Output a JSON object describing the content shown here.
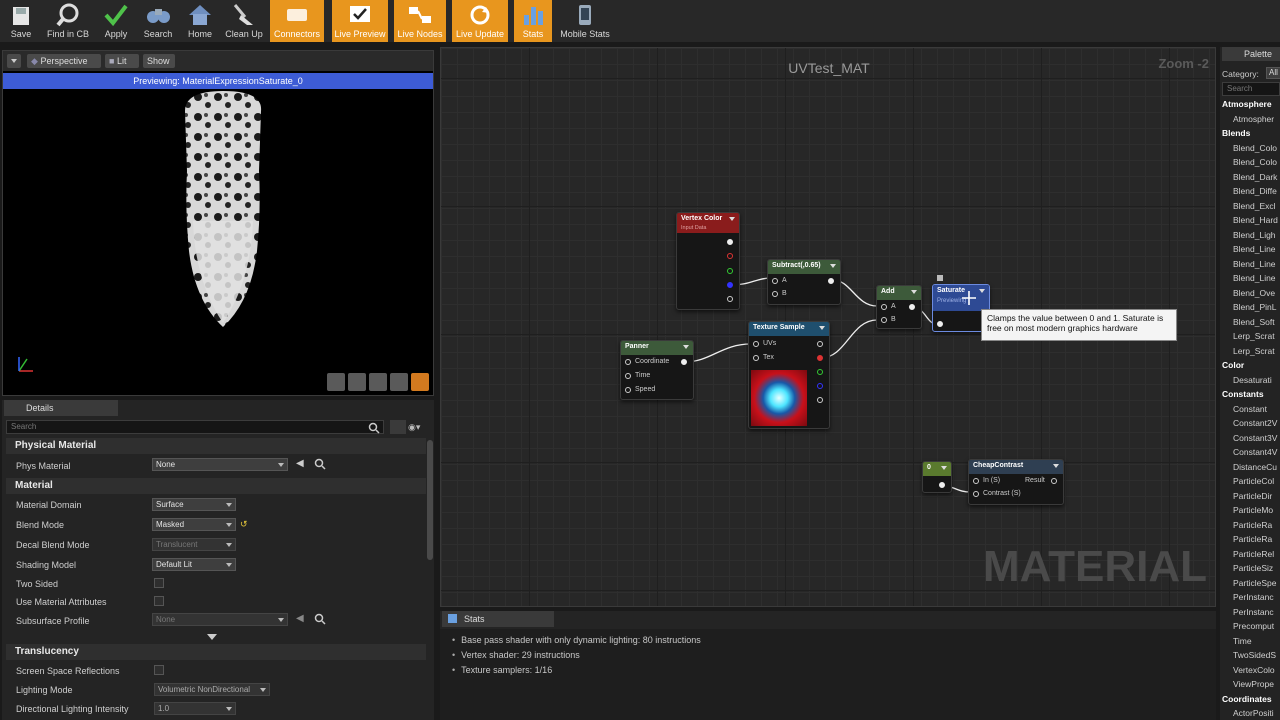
{
  "toolbar": {
    "buttons": [
      {
        "label": "Save",
        "icon": "save-icon",
        "active": false
      },
      {
        "label": "Find in CB",
        "icon": "magnifier-icon",
        "active": false
      },
      {
        "label": "Apply",
        "icon": "checkmark-icon",
        "active": false
      },
      {
        "label": "Search",
        "icon": "binoculars-icon",
        "active": false
      },
      {
        "label": "Home",
        "icon": "home-icon",
        "active": false
      },
      {
        "label": "Clean Up",
        "icon": "broom-icon",
        "active": false
      },
      {
        "label": "Connectors",
        "icon": "connectors-icon",
        "active": true
      },
      {
        "label": "Live Preview",
        "icon": "live-preview-icon",
        "active": true
      },
      {
        "label": "Live Nodes",
        "icon": "live-nodes-icon",
        "active": true
      },
      {
        "label": "Live Update",
        "icon": "live-update-icon",
        "active": true
      },
      {
        "label": "Stats",
        "icon": "stats-icon",
        "active": true
      },
      {
        "label": "Mobile Stats",
        "icon": "mobile-stats-icon",
        "active": false
      }
    ],
    "colors": {
      "active": "#e8961e",
      "bg": "#282828"
    }
  },
  "viewport": {
    "perspective_label": "Perspective",
    "lit_label": "Lit",
    "show_label": "Show",
    "preview_text": "Previewing: MaterialExpressionSaturate_0"
  },
  "details": {
    "tab_label": "Details",
    "search_placeholder": "Search",
    "sections": {
      "physical_material": "Physical Material",
      "material": "Material",
      "translucency": "Translucency"
    },
    "props": {
      "phys_material": {
        "label": "Phys Material",
        "value": "None"
      },
      "material_domain": {
        "label": "Material Domain",
        "value": "Surface"
      },
      "blend_mode": {
        "label": "Blend Mode",
        "value": "Masked"
      },
      "decal_blend_mode": {
        "label": "Decal Blend Mode",
        "value": "Translucent"
      },
      "shading_model": {
        "label": "Shading Model",
        "value": "Default Lit"
      },
      "two_sided": {
        "label": "Two Sided"
      },
      "use_material_attributes": {
        "label": "Use Material Attributes"
      },
      "subsurface_profile": {
        "label": "Subsurface Profile",
        "value": "None"
      },
      "ssr": {
        "label": "Screen Space Reflections"
      },
      "lighting_mode": {
        "label": "Lighting Mode",
        "value": "Volumetric NonDirectional"
      },
      "dir_light_intensity": {
        "label": "Directional Lighting Intensity",
        "value": "1.0"
      }
    }
  },
  "graph": {
    "title": "UVTest_MAT",
    "zoom": "Zoom -2",
    "watermark": "MATERIAL",
    "nodes": {
      "vertex_color": {
        "title": "Vertex Color",
        "subtitle": "Input Data"
      },
      "subtract": {
        "title": "Subtract(,0.65)",
        "pin_a": "A",
        "pin_b": "B"
      },
      "add": {
        "title": "Add",
        "pin_a": "A",
        "pin_b": "B"
      },
      "saturate": {
        "title": "Saturate",
        "status": "Previewing"
      },
      "panner": {
        "title": "Panner",
        "pins": [
          "Coordinate",
          "Time",
          "Speed"
        ]
      },
      "texture_sample": {
        "title": "Texture Sample",
        "pin_uvs": "UVs",
        "pin_tex": "Tex"
      },
      "constant": {
        "title": "0"
      },
      "cheap_contrast": {
        "title": "CheapContrast",
        "pin_in": "In (S)",
        "pin_result": "Result",
        "pin_contrast": "Contrast (S)"
      }
    },
    "tooltip": "Clamps the value between 0 and 1. Saturate is free on most modern graphics hardware"
  },
  "palette": {
    "tab_label": "Palette",
    "category_label": "Category:",
    "category_value": "All",
    "search_placeholder": "Search",
    "entries": [
      {
        "text": "Atmosphere",
        "type": "cat"
      },
      {
        "text": "Atmospher",
        "type": "item"
      },
      {
        "text": "Blends",
        "type": "cat"
      },
      {
        "text": "Blend_Colo",
        "type": "item"
      },
      {
        "text": "Blend_Colo",
        "type": "item"
      },
      {
        "text": "Blend_Dark",
        "type": "item"
      },
      {
        "text": "Blend_Diffe",
        "type": "item"
      },
      {
        "text": "Blend_Excl",
        "type": "item"
      },
      {
        "text": "Blend_Hard",
        "type": "item"
      },
      {
        "text": "Blend_Ligh",
        "type": "item"
      },
      {
        "text": "Blend_Line",
        "type": "item"
      },
      {
        "text": "Blend_Line",
        "type": "item"
      },
      {
        "text": "Blend_Line",
        "type": "item"
      },
      {
        "text": "Blend_Ove",
        "type": "item"
      },
      {
        "text": "Blend_PinL",
        "type": "item"
      },
      {
        "text": "Blend_Soft",
        "type": "item"
      },
      {
        "text": "Lerp_Scrat",
        "type": "item"
      },
      {
        "text": "Lerp_Scrat",
        "type": "item"
      },
      {
        "text": "Color",
        "type": "cat"
      },
      {
        "text": "Desaturati",
        "type": "item"
      },
      {
        "text": "Constants",
        "type": "cat"
      },
      {
        "text": "Constant",
        "type": "item"
      },
      {
        "text": "Constant2V",
        "type": "item"
      },
      {
        "text": "Constant3V",
        "type": "item"
      },
      {
        "text": "Constant4V",
        "type": "item"
      },
      {
        "text": "DistanceCu",
        "type": "item"
      },
      {
        "text": "ParticleCol",
        "type": "item"
      },
      {
        "text": "ParticleDir",
        "type": "item"
      },
      {
        "text": "ParticleMo",
        "type": "item"
      },
      {
        "text": "ParticleRa",
        "type": "item"
      },
      {
        "text": "ParticleRa",
        "type": "item"
      },
      {
        "text": "ParticleRel",
        "type": "item"
      },
      {
        "text": "ParticleSiz",
        "type": "item"
      },
      {
        "text": "ParticleSpe",
        "type": "item"
      },
      {
        "text": "PerInstanc",
        "type": "item"
      },
      {
        "text": "PerInstanc",
        "type": "item"
      },
      {
        "text": "Precomput",
        "type": "item"
      },
      {
        "text": "Time",
        "type": "item"
      },
      {
        "text": "TwoSidedS",
        "type": "item"
      },
      {
        "text": "VertexColo",
        "type": "item"
      },
      {
        "text": "ViewPrope",
        "type": "item"
      },
      {
        "text": "Coordinates",
        "type": "cat"
      },
      {
        "text": "ActorPositi",
        "type": "item"
      }
    ]
  },
  "stats": {
    "tab_label": "Stats",
    "lines": [
      "Base pass shader with only dynamic lighting: 80 instructions",
      "Vertex shader: 29 instructions",
      "Texture samplers: 1/16"
    ]
  }
}
